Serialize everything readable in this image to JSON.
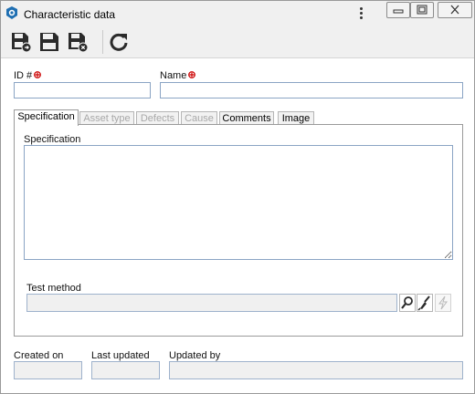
{
  "window": {
    "title": "Characteristic data",
    "icons": [
      "app-logo-icon",
      "more-options-icon",
      "minimize-icon",
      "maximize-icon",
      "close-icon"
    ]
  },
  "toolbar": {
    "buttons": [
      {
        "name": "save-and-new-button",
        "icon": "save-new-icon"
      },
      {
        "name": "save-button",
        "icon": "save-icon"
      },
      {
        "name": "save-and-close-button",
        "icon": "save-close-icon"
      },
      {
        "name": "refresh-button",
        "icon": "refresh-icon"
      }
    ]
  },
  "fields": {
    "id_label": "ID #",
    "id_value": "",
    "name_label": "Name",
    "name_value": ""
  },
  "tabs": [
    {
      "label": "Specification",
      "state": "active"
    },
    {
      "label": "Asset type",
      "state": "disabled"
    },
    {
      "label": "Defects",
      "state": "disabled"
    },
    {
      "label": "Cause",
      "state": "disabled"
    },
    {
      "label": "Comments",
      "state": "enabled"
    },
    {
      "label": "Image",
      "state": "enabled"
    }
  ],
  "specification": {
    "label": "Specification",
    "value": "",
    "test_method_label": "Test method",
    "test_method_value": ""
  },
  "footer": {
    "created_on_label": "Created on",
    "created_on_value": "",
    "last_updated_label": "Last updated",
    "last_updated_value": "",
    "updated_by_label": "Updated by",
    "updated_by_value": ""
  },
  "colors": {
    "required_marker": "#cc0000",
    "field_border": "#8aa4c4",
    "active_tab_text": "#000000",
    "disabled_tab_text": "#a8a8a8"
  }
}
